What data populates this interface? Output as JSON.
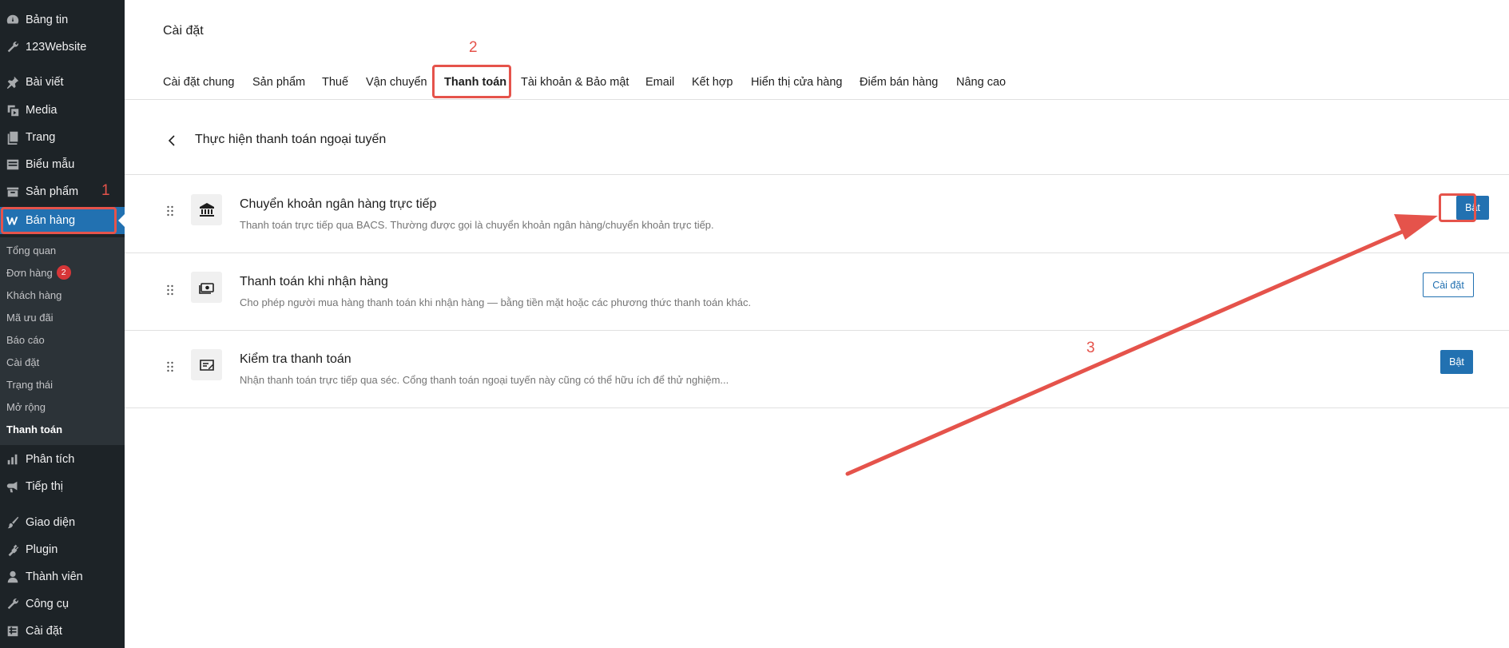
{
  "sidebar": {
    "top_items": [
      {
        "label": "Bảng tin",
        "icon": "dashboard-icon"
      },
      {
        "label": "123Website",
        "icon": "wrench-icon"
      },
      {
        "label": "Bài viết",
        "icon": "pin-icon"
      },
      {
        "label": "Media",
        "icon": "media-icon"
      },
      {
        "label": "Trang",
        "icon": "pages-icon"
      },
      {
        "label": "Biểu mẫu",
        "icon": "forms-icon"
      },
      {
        "label": "Sản phẩm",
        "icon": "archive-icon"
      },
      {
        "label": "Bán hàng",
        "icon": "woocommerce-icon"
      }
    ],
    "submenu": [
      {
        "label": "Tổng quan"
      },
      {
        "label": "Đơn hàng",
        "badge": "2"
      },
      {
        "label": "Khách hàng"
      },
      {
        "label": "Mã ưu đãi"
      },
      {
        "label": "Báo cáo"
      },
      {
        "label": "Cài đặt"
      },
      {
        "label": "Trạng thái"
      },
      {
        "label": "Mở rộng"
      },
      {
        "label": "Thanh toán"
      }
    ],
    "bottom_items": [
      {
        "label": "Phân tích",
        "icon": "chart-icon"
      },
      {
        "label": "Tiếp thị",
        "icon": "megaphone-icon"
      },
      {
        "label": "Giao diện",
        "icon": "brush-icon"
      },
      {
        "label": "Plugin",
        "icon": "plugin-icon"
      },
      {
        "label": "Thành viên",
        "icon": "user-icon"
      },
      {
        "label": "Công cụ",
        "icon": "tools-icon"
      },
      {
        "label": "Cài đặt",
        "icon": "settings-icon"
      }
    ]
  },
  "header": {
    "title": "Cài đặt",
    "tabs": [
      {
        "label": "Cài đặt chung"
      },
      {
        "label": "Sản phẩm"
      },
      {
        "label": "Thuế"
      },
      {
        "label": "Vận chuyển"
      },
      {
        "label": "Thanh toán"
      },
      {
        "label": "Tài khoản & Bảo mật"
      },
      {
        "label": "Email"
      },
      {
        "label": "Kết hợp"
      },
      {
        "label": "Hiển thị cửa hàng"
      },
      {
        "label": "Điểm bán hàng"
      },
      {
        "label": "Nâng cao"
      }
    ],
    "active_tab": "Thanh toán"
  },
  "section": {
    "title": "Thực hiện thanh toán ngoại tuyến"
  },
  "payment_methods": [
    {
      "title": "Chuyển khoản ngân hàng trực tiếp",
      "description": "Thanh toán trực tiếp qua BACS. Thường được gọi là chuyển khoản ngân hàng/chuyển khoản trực tiếp.",
      "button": "Bật",
      "icon": "bank-icon"
    },
    {
      "title": "Thanh toán khi nhận hàng",
      "description": "Cho phép người mua hàng thanh toán khi nhận hàng — bằng tiền mặt hoặc các phương thức thanh toán khác.",
      "button": "Cài đặt",
      "icon": "cash-icon"
    },
    {
      "title": "Kiểm tra thanh toán",
      "description": "Nhận thanh toán trực tiếp qua séc. Cổng thanh toán ngoại tuyến này cũng có thể hữu ích để thử nghiệm...",
      "button": "Bật",
      "icon": "cheque-icon"
    }
  ],
  "annotations": {
    "step1": "1",
    "step2": "2",
    "step3": "3",
    "color": "#e5534b"
  },
  "colors": {
    "sidebar_bg": "#1d2327",
    "accent": "#2271b1"
  }
}
